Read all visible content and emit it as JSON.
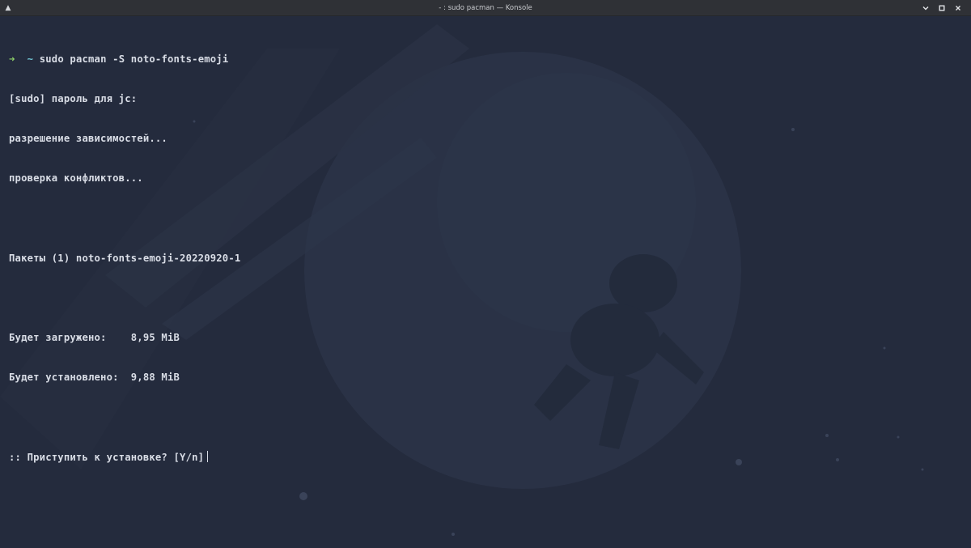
{
  "window": {
    "title": "- : sudo pacman — Konsole",
    "menu_icon": "chevron-up-icon",
    "controls": [
      {
        "name": "minimize-icon",
        "glyph": "⌄"
      },
      {
        "name": "maximize-icon",
        "glyph": "▫"
      },
      {
        "name": "close-icon",
        "glyph": "✕"
      }
    ]
  },
  "terminal": {
    "prompt_arrow": "➜",
    "prompt_dir": "~",
    "command": "sudo pacman -S noto-fonts-emoji",
    "lines": [
      "[sudo] пароль для jc:",
      "разрешение зависимостей...",
      "проверка конфликтов...",
      "",
      "Пакеты (1) noto-fonts-emoji-20220920-1",
      "",
      "Будет загружено:    8,95 MiB",
      "Будет установлено:  9,88 MiB",
      ""
    ],
    "question": ":: Приступить к установке? [Y/n]"
  },
  "colors": {
    "background": "#242b3d",
    "text": "#d9dde6",
    "prompt_arrow": "#8fd26a",
    "prompt_dir": "#6fc3d2",
    "titlebar": "#2f3136"
  }
}
